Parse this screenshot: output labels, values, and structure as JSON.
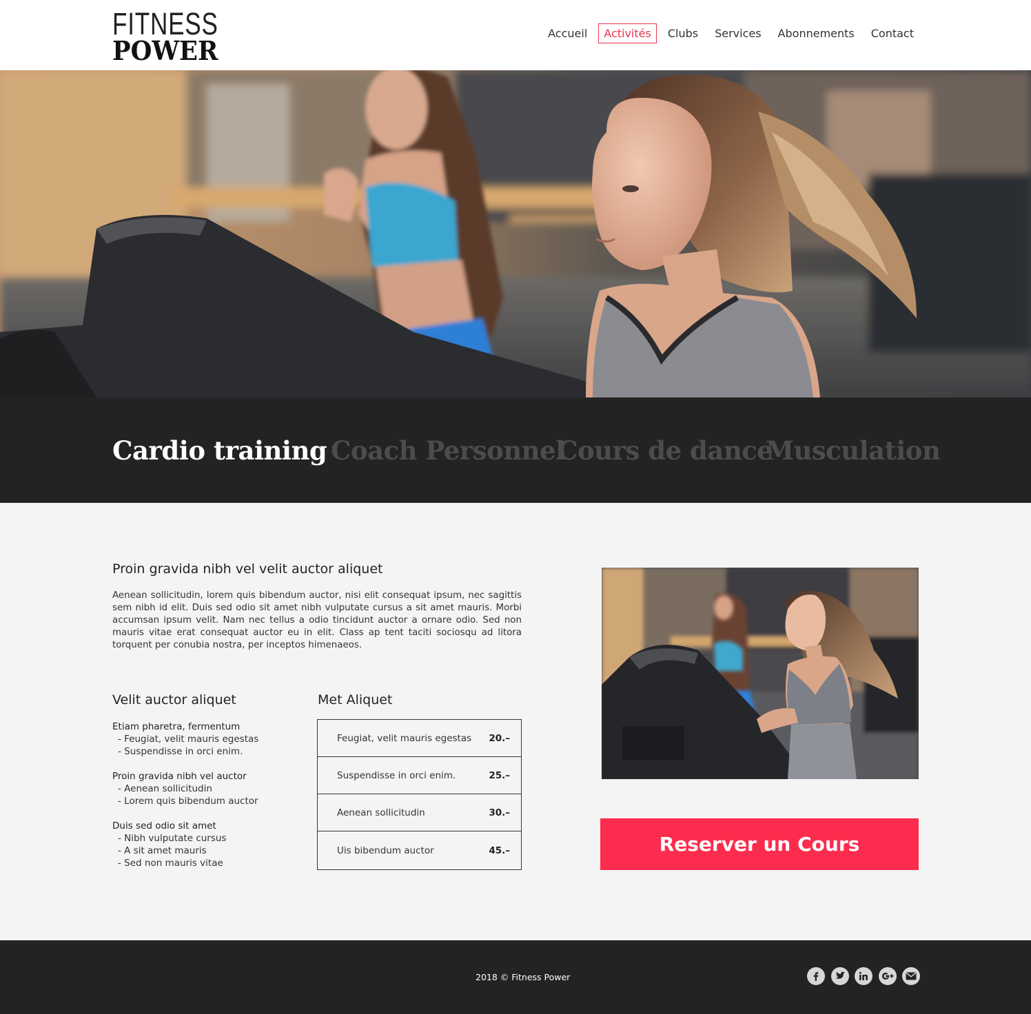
{
  "brand": {
    "line1": "FITNESS",
    "line2": "POWER"
  },
  "nav": {
    "items": [
      "Accueil",
      "Activités",
      "Clubs",
      "Services",
      "Abonnements",
      "Contact"
    ],
    "active_index": 1,
    "active_color": "#e8344f"
  },
  "tabs": {
    "items": [
      "Cardio training",
      "Coach Personnel",
      "Cours de dance",
      "Musculation"
    ],
    "active_index": 0
  },
  "content": {
    "heading": "Proin gravida nibh vel velit auctor aliquet",
    "paragraph": "Aenean sollicitudin, lorem quis bibendum auctor, nisi elit consequat ipsum, nec sagittis sem nibh id elit. Duis sed odio sit amet nibh vulputate cursus a sit amet mauris. Morbi accumsan ipsum velit. Nam nec tellus a odio tincidunt auctor a ornare odio. Sed non  mauris vitae erat consequat auctor eu in elit. Class ap tent taciti sociosqu ad litora torquent per conubia nostra, per inceptos himenaeos.",
    "left_heading": "Velit auctor aliquet",
    "groups": [
      {
        "title": "Etiam pharetra, fermentum",
        "items": [
          "- Feugiat, velit mauris egestas",
          "- Suspendisse in orci enim."
        ]
      },
      {
        "title": "Proin gravida nibh vel auctor",
        "items": [
          "- Aenean sollicitudin",
          "- Lorem quis bibendum auctor"
        ]
      },
      {
        "title": "Duis sed odio sit amet",
        "items": [
          "- Nibh vulputate cursus",
          "- A sit amet mauris",
          "- Sed non mauris vitae"
        ]
      }
    ],
    "right_heading": "Met Aliquet",
    "prices": [
      {
        "label": "Feugiat, velit mauris egestas",
        "price": "20.–"
      },
      {
        "label": "Suspendisse in orci enim.",
        "price": "25.–"
      },
      {
        "label": "Aenean sollicitudin",
        "price": "30.–"
      },
      {
        "label": "Uis bibendum auctor",
        "price": "45.–"
      }
    ],
    "cta_label": "Reserver un Cours",
    "cta_color": "#fc2c4e"
  },
  "footer": {
    "copyright": "2018 © Fitness Power",
    "socials": [
      "facebook-icon",
      "twitter-icon",
      "linkedin-icon",
      "google-plus-icon",
      "email-icon"
    ]
  }
}
